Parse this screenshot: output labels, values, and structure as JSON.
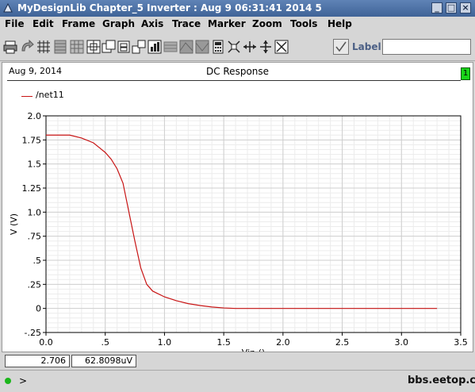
{
  "window": {
    "title": "MyDesignLib Chapter_5 Inverter : Aug  9 06:31:41 2014 5",
    "controls": [
      "minimize",
      "maximize",
      "close"
    ]
  },
  "menu": [
    "File",
    "Edit",
    "Frame",
    "Graph",
    "Axis",
    "Trace",
    "Marker",
    "Zoom",
    "Tools",
    "Help"
  ],
  "toolbar": {
    "icons": [
      "print-icon",
      "refresh-icon",
      "grid-icon",
      "strip-icon",
      "table-icon",
      "zoom-fit-icon",
      "duplicate-icon",
      "frame-icon",
      "link-icon",
      "bars-icon",
      "shade-icon",
      "contour-icon",
      "calculator-icon",
      "zoom-in-icon",
      "pan-x-icon",
      "pan-y-icon",
      "fit-icon"
    ],
    "label_text": "Label",
    "label_value": ""
  },
  "graph": {
    "date": "Aug 9, 2014",
    "title": "DC Response",
    "badge": "1"
  },
  "cursor": {
    "x_value": "2.706",
    "y_value": "62.8098uV"
  },
  "status": {
    "prompt": ">",
    "watermark": "bbs.eetop.cn"
  },
  "colors": {
    "title_bar": "#4b6fa3",
    "trace": "#c81414",
    "grid": "#cfcfcf",
    "badge": "#19d419"
  },
  "chart_data": {
    "type": "line",
    "title": "DC Response",
    "xlabel": "Vin ()",
    "ylabel": "V (V)",
    "xlim": [
      0,
      3.5
    ],
    "ylim": [
      -0.25,
      2.0
    ],
    "x_ticks": [
      "0.0",
      ".5",
      "1.0",
      "1.5",
      "2.0",
      "2.5",
      "3.0",
      "3.5"
    ],
    "y_ticks": [
      "-.25",
      "0",
      ".25",
      ".5",
      ".75",
      "1.0",
      "1.25",
      "1.5",
      "1.75",
      "2.0"
    ],
    "grid": true,
    "legend_position": "top-left",
    "series": [
      {
        "name": "/net11",
        "x": [
          0.0,
          0.2,
          0.3,
          0.4,
          0.5,
          0.55,
          0.6,
          0.65,
          0.7,
          0.75,
          0.8,
          0.85,
          0.9,
          1.0,
          1.1,
          1.2,
          1.3,
          1.4,
          1.5,
          1.6,
          2.0,
          2.5,
          3.0,
          3.3
        ],
        "y": [
          1.8,
          1.8,
          1.77,
          1.72,
          1.62,
          1.55,
          1.45,
          1.3,
          1.0,
          0.7,
          0.42,
          0.25,
          0.18,
          0.12,
          0.08,
          0.05,
          0.03,
          0.015,
          0.005,
          0.0,
          0.0,
          0.0,
          0.0,
          0.0
        ]
      }
    ]
  }
}
